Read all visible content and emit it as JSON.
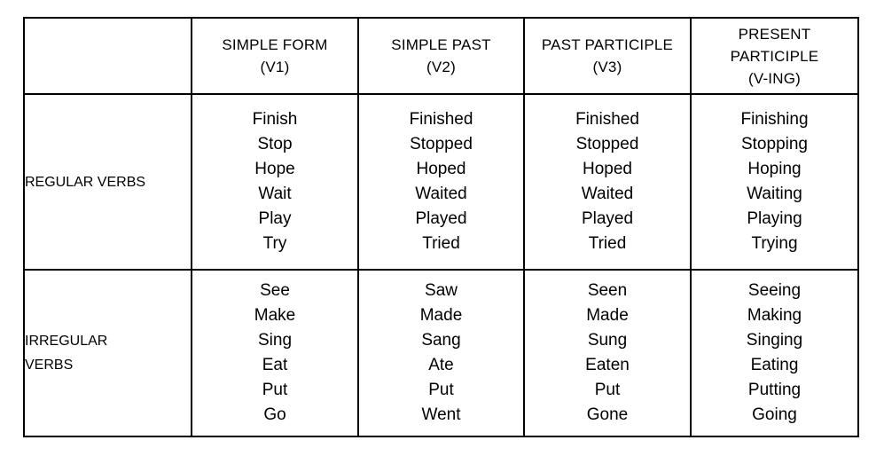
{
  "table": {
    "corner_label": "",
    "columns": [
      {
        "key": "row_label",
        "header_lines": []
      },
      {
        "key": "v1",
        "header_lines": [
          "SIMPLE FORM",
          "(V1)"
        ]
      },
      {
        "key": "v2",
        "header_lines": [
          "SIMPLE PAST",
          "(V2)"
        ]
      },
      {
        "key": "v3",
        "header_lines": [
          "PAST PARTICIPLE",
          "(V3)"
        ]
      },
      {
        "key": "ving",
        "header_lines": [
          "PRESENT",
          "PARTICIPLE",
          "(V-ING)"
        ]
      }
    ],
    "rows": [
      {
        "label_lines": [
          "REGULAR VERBS"
        ],
        "v1": [
          "Finish",
          "Stop",
          "Hope",
          "Wait",
          "Play",
          "Try"
        ],
        "v2": [
          "Finished",
          "Stopped",
          "Hoped",
          "Waited",
          "Played",
          "Tried"
        ],
        "v3": [
          "Finished",
          "Stopped",
          "Hoped",
          "Waited",
          "Played",
          "Tried"
        ],
        "ving": [
          "Finishing",
          "Stopping",
          "Hoping",
          "Waiting",
          "Playing",
          "Trying"
        ]
      },
      {
        "label_lines": [
          "IRREGULAR",
          "VERBS"
        ],
        "v1": [
          "See",
          "Make",
          "Sing",
          "Eat",
          "Put",
          "Go"
        ],
        "v2": [
          "Saw",
          "Made",
          "Sang",
          "Ate",
          "Put",
          "Went"
        ],
        "v3": [
          "Seen",
          "Made",
          "Sung",
          "Eaten",
          "Put",
          "Gone"
        ],
        "ving": [
          "Seeing",
          "Making",
          "Singing",
          "Eating",
          "Putting",
          "Going"
        ]
      }
    ]
  },
  "colors": {
    "header_background": "#FFFF00",
    "row_label_background": "#FFFF00",
    "cell_background": "#FFFFFF",
    "border": "#000000",
    "text": "#000000"
  }
}
